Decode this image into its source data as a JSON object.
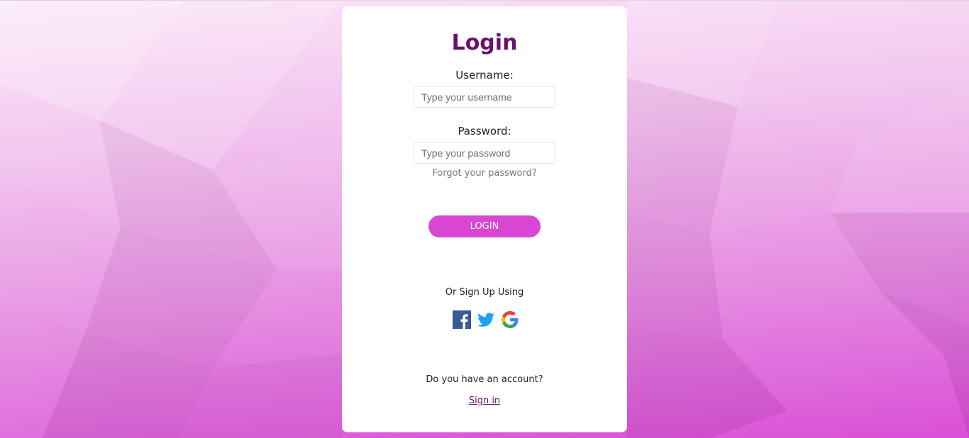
{
  "login": {
    "title": "Login",
    "username_label": "Username:",
    "username_placeholder": "Type your username",
    "password_label": "Password:",
    "password_placeholder": "Type your password",
    "forgot_text": "Forgot your password?",
    "login_button": "LOGIN",
    "or_text": "Or Sign Up Using",
    "social_icons": [
      "facebook-icon",
      "twitter-icon",
      "google-icon"
    ],
    "account_text": "Do you have an account?",
    "signin_text": "Sign in"
  },
  "colors": {
    "title": "#6a0f6a",
    "button": "#d946d4",
    "background_top": "#fbe6f8",
    "background_bottom": "#d94bd6",
    "facebook": "#3b5998",
    "twitter": "#1da1f2"
  }
}
